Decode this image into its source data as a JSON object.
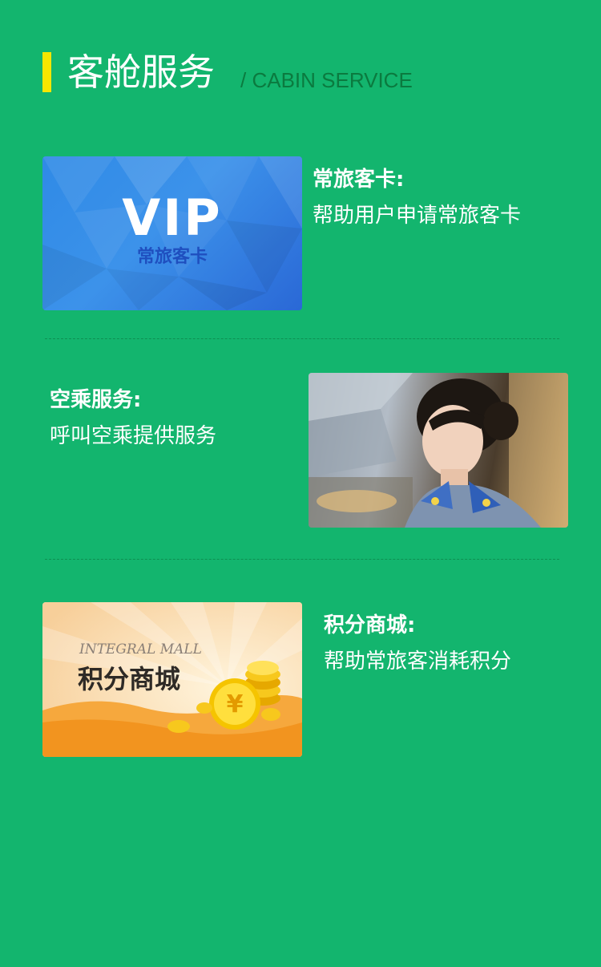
{
  "header": {
    "title": "客舱服务",
    "subtitle": "/ CABIN SERVICE"
  },
  "items": [
    {
      "title": "常旅客卡:",
      "desc": "帮助用户申请常旅客卡",
      "image": {
        "main_text": "VIP",
        "sub_text": "常旅客卡"
      }
    },
    {
      "title": "空乘服务:",
      "desc": "呼叫空乘提供服务",
      "image": {
        "alt": "flight-attendant-photo"
      }
    },
    {
      "title": "积分商城:",
      "desc": "帮助常旅客消耗积分",
      "image": {
        "main_text": "积分商城",
        "sub_text": "INTEGRAL MALL"
      }
    }
  ],
  "colors": {
    "background": "#13b56e",
    "accent_bar": "#f7e600",
    "subtitle": "#0b7a3f"
  }
}
